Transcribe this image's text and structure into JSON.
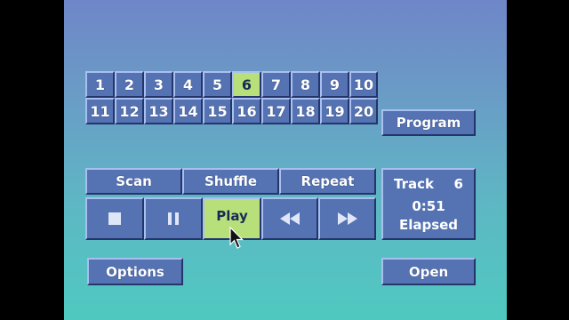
{
  "track_buttons": [
    "1",
    "2",
    "3",
    "4",
    "5",
    "6",
    "7",
    "8",
    "9",
    "10",
    "11",
    "12",
    "13",
    "14",
    "15",
    "16",
    "17",
    "18",
    "19",
    "20"
  ],
  "selected_track": "6",
  "program_label": "Program",
  "mode_buttons": {
    "scan": "Scan",
    "shuffle": "Shuffle",
    "repeat": "Repeat"
  },
  "transport": {
    "play_label": "Play",
    "active": "play"
  },
  "status": {
    "track_label": "Track",
    "track_number": "6",
    "time": "0:51",
    "time_mode": "Elapsed"
  },
  "options_label": "Options",
  "open_label": "Open",
  "icons": {
    "stop": "stop-icon",
    "pause": "pause-icon",
    "rewind": "rewind-icon",
    "fast_forward": "fast-forward-icon",
    "cursor": "mouse-pointer-icon"
  },
  "colors": {
    "button": "#5572b2",
    "highlight": "#b8e07a"
  }
}
